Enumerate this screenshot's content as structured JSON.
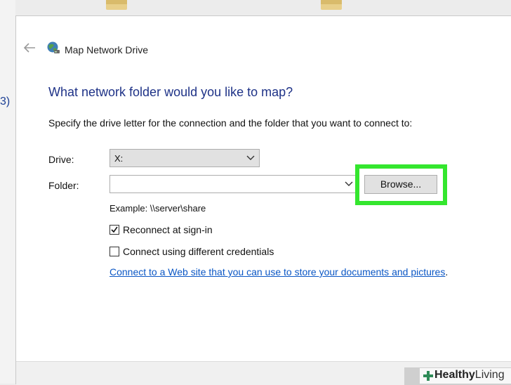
{
  "background": {
    "partial_text": "3)"
  },
  "dialog": {
    "title": "Map Network Drive",
    "heading": "What network folder would you like to map?",
    "instruction": "Specify the drive letter for the connection and the folder that you want to connect to:",
    "drive": {
      "label": "Drive:",
      "value": "X:"
    },
    "folder": {
      "label": "Folder:",
      "value": ""
    },
    "browse_label": "Browse...",
    "example": "Example: \\\\server\\share",
    "reconnect": {
      "label": "Reconnect at sign-in",
      "checked": true
    },
    "different_credentials": {
      "label": "Connect using different credentials",
      "checked": false
    },
    "link_text": "Connect to a Web site that you can use to store your documents and pictures",
    "link_suffix": "."
  },
  "watermark": {
    "brand_bold": "Healthy",
    "brand_thin": "Living"
  },
  "colors": {
    "highlight": "#34e62e",
    "heading": "#1e3287",
    "link": "#0b57c5"
  }
}
